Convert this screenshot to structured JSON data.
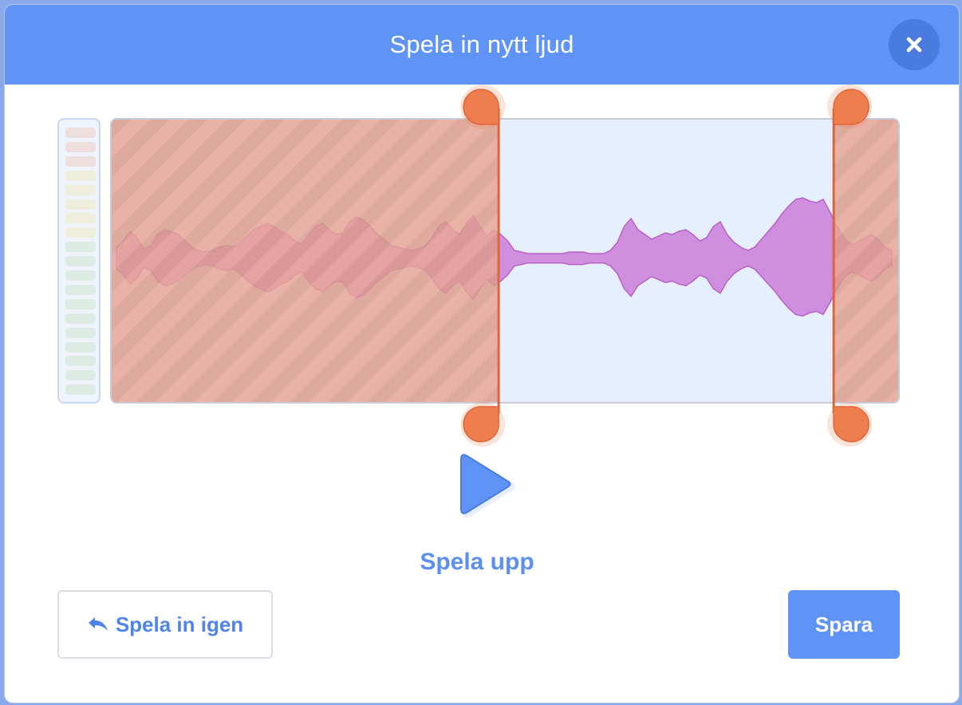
{
  "dialog": {
    "title": "Spela in nytt ljud",
    "close_icon": "close-icon"
  },
  "colors": {
    "header": "#5f94f6",
    "accent": "#5b8ff0",
    "trim_handle": "#ef7e4e",
    "trim_line": "#e0643a",
    "trimmed_fill": "#e7a08c",
    "waveform": "#cf8fde",
    "waveform_stroke": "#b760c6",
    "wave_background": "#e6effe"
  },
  "recording": {
    "trim_start": 0.492,
    "trim_end": 0.918
  },
  "playback": {
    "play_icon": "play-icon",
    "play_label": "Spela upp"
  },
  "actions": {
    "rerecord_icon": "undo-arrow-icon",
    "rerecord_label": "Spela in igen",
    "save_label": "Spara"
  }
}
